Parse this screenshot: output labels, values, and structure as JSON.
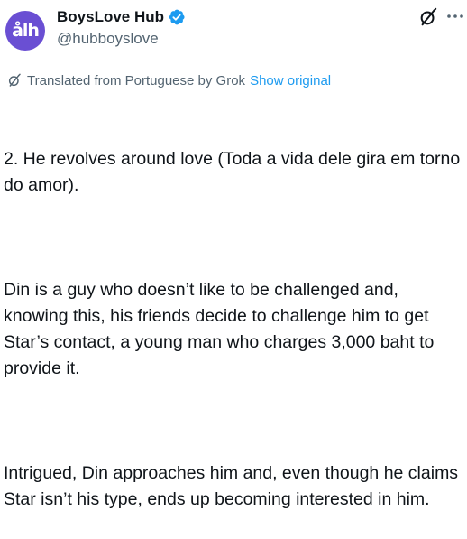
{
  "account": {
    "avatar_text": "ålh",
    "display_name": "BoysLove Hub",
    "handle": "@hubboyslove",
    "verified": true
  },
  "icons": {
    "verified": "verified-badge-icon",
    "grok": "grok-icon",
    "more": "more-options-icon"
  },
  "translation": {
    "label": "Translated from Portuguese by Grok",
    "show_original": "Show original"
  },
  "tweet": {
    "paragraphs": [
      "2. He revolves around love (Toda a vida dele gira em torno do amor).",
      "Din is a guy who doesn’t like to be challenged and, knowing this, his friends decide to challenge him to get Star’s contact, a young man who charges 3,000 baht to provide it.",
      "Intrigued, Din approaches him and, even though he claims Star isn’t his type, ends up becoming interested in him."
    ]
  },
  "colors": {
    "text": "#0f1419",
    "muted": "#536471",
    "link": "#1d9bf0",
    "avatar_bg": "#6a4fd3"
  }
}
